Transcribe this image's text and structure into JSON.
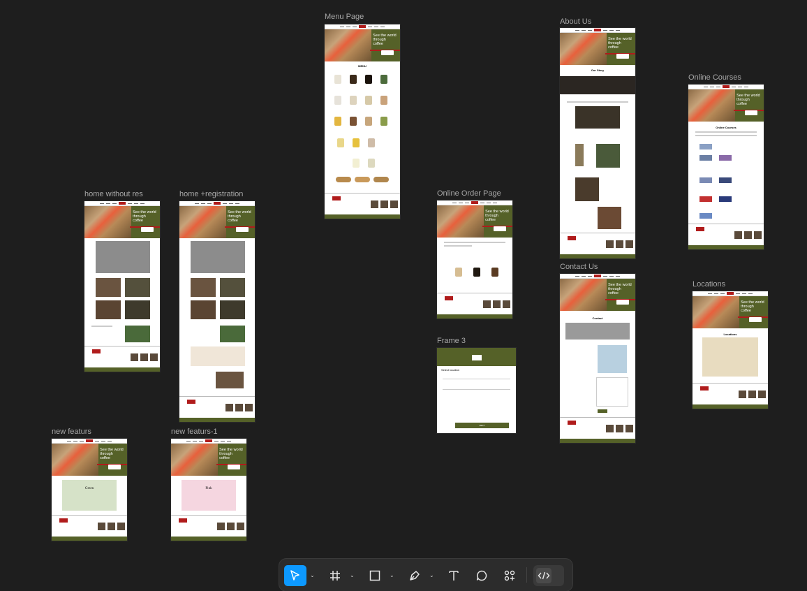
{
  "canvas": {
    "frame_labels": {
      "menu": "Menu Page",
      "about": "About Us",
      "courses": "Online Courses",
      "home_nores": "home without res",
      "home_reg": "home +registration",
      "order": "Online Order Page",
      "contact": "Contact Us",
      "locations": "Locations",
      "frame3": "Frame 3",
      "feat": "new featurs",
      "feat1": "new featurs-1"
    }
  },
  "frame_text": {
    "hero_tagline": "See the world through coffee",
    "logo": "CỘNG",
    "menu_heading": "MENU",
    "our_story": "Our Story",
    "courses_heading": "Online Courses",
    "contact_heading": "Contact",
    "locations_heading": "Locations",
    "green_heading": "Green",
    "pink_heading": "Pink",
    "select_location": "Select location",
    "next_button": "NEXT"
  },
  "toolbar": {
    "tools": [
      {
        "id": "move",
        "icon": "cursor-icon",
        "selected": true
      },
      {
        "id": "frame",
        "icon": "hash-frame-icon"
      },
      {
        "id": "shape",
        "icon": "rectangle-icon"
      },
      {
        "id": "pen",
        "icon": "pen-icon"
      },
      {
        "id": "text",
        "icon": "text-icon"
      },
      {
        "id": "comment",
        "icon": "comment-icon"
      },
      {
        "id": "actions",
        "icon": "actions-icon"
      },
      {
        "id": "dev",
        "icon": "code-icon"
      }
    ],
    "accent": "#0d99ff"
  },
  "colors": {
    "canvas": "#1e1e1e",
    "brand_green": "#556128",
    "brand_red": "#b01b1b"
  }
}
